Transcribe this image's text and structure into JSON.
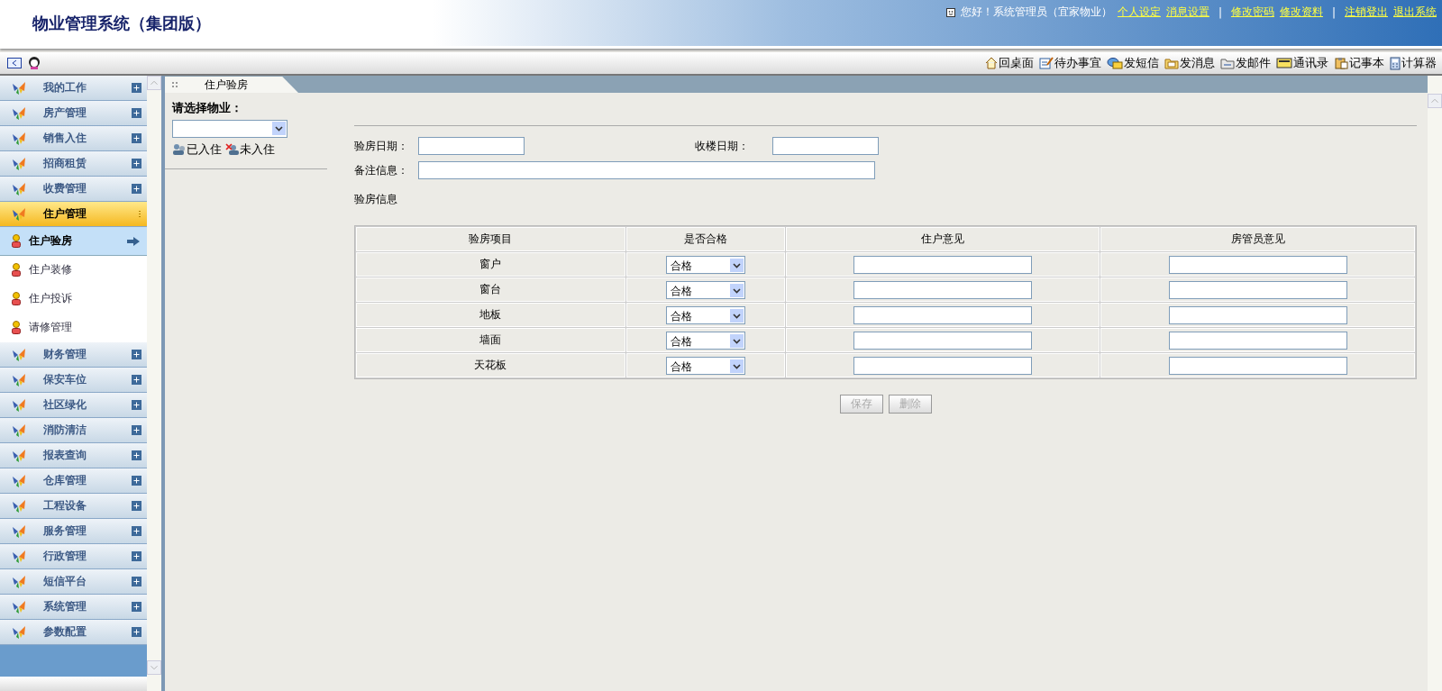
{
  "header": {
    "title": "物业管理系统（集团版）",
    "greeting": "您好！系统管理员（宜家物业）",
    "links": [
      {
        "kind": "link",
        "label": "个人设定"
      },
      {
        "kind": "link",
        "label": "消息设置"
      },
      {
        "kind": "separator",
        "label": "|"
      },
      {
        "kind": "link",
        "label": "修改密码"
      },
      {
        "kind": "link",
        "label": "修改资料"
      },
      {
        "kind": "separator",
        "label": "|"
      },
      {
        "kind": "link",
        "label": "注销登出"
      },
      {
        "kind": "link",
        "label": "退出系统"
      }
    ]
  },
  "toolbar": [
    {
      "kind": "home",
      "label": "回桌面"
    },
    {
      "kind": "todo",
      "label": "待办事宜"
    },
    {
      "kind": "sms",
      "label": "发短信"
    },
    {
      "kind": "message",
      "label": "发消息"
    },
    {
      "kind": "mail",
      "label": "发邮件"
    },
    {
      "kind": "contacts",
      "label": "通讯录"
    },
    {
      "kind": "notes",
      "label": "记事本"
    },
    {
      "kind": "calculator",
      "label": "计算器"
    }
  ],
  "sidebar": {
    "items": [
      {
        "label": "我的工作",
        "expanded": false
      },
      {
        "label": "房产管理",
        "expanded": false
      },
      {
        "label": "销售入住",
        "expanded": false
      },
      {
        "label": "招商租赁",
        "expanded": false
      },
      {
        "label": "收费管理",
        "expanded": false
      },
      {
        "label": "住户管理",
        "expanded": true,
        "children": [
          {
            "label": "住户验房",
            "selected": true
          },
          {
            "label": "住户装修",
            "selected": false
          },
          {
            "label": "住户投诉",
            "selected": false
          },
          {
            "label": "请修管理",
            "selected": false
          }
        ]
      },
      {
        "label": "财务管理",
        "expanded": false
      },
      {
        "label": "保安车位",
        "expanded": false
      },
      {
        "label": "社区绿化",
        "expanded": false
      },
      {
        "label": "消防清洁",
        "expanded": false
      },
      {
        "label": "报表查询",
        "expanded": false
      },
      {
        "label": "仓库管理",
        "expanded": false
      },
      {
        "label": "工程设备",
        "expanded": false
      },
      {
        "label": "服务管理",
        "expanded": false
      },
      {
        "label": "行政管理",
        "expanded": false
      },
      {
        "label": "短信平台",
        "expanded": false
      },
      {
        "label": "系统管理",
        "expanded": false
      },
      {
        "label": "参数配置",
        "expanded": false
      }
    ]
  },
  "tab": {
    "label": "住户验房"
  },
  "property_panel": {
    "label": "请选择物业：",
    "filters": [
      {
        "kind": "occupied",
        "label": "已入住"
      },
      {
        "kind": "vacant",
        "label": "未入住"
      }
    ]
  },
  "form": {
    "fields": [
      {
        "label": "验房日期："
      },
      {
        "label": "收楼日期："
      },
      {
        "label": "备注信息："
      }
    ],
    "section": "验房信息",
    "table": {
      "columns": [
        "验房项目",
        "是否合格",
        "住户意见",
        "房管员意见"
      ],
      "rows": [
        {
          "item": "窗户",
          "result": "合格"
        },
        {
          "item": "窗台",
          "result": "合格"
        },
        {
          "item": "地板",
          "result": "合格"
        },
        {
          "item": "墙面",
          "result": "合格"
        },
        {
          "item": "天花板",
          "result": "合格"
        }
      ]
    },
    "buttons": [
      {
        "label": "保存",
        "disabled": true
      },
      {
        "label": "删除",
        "disabled": true
      }
    ]
  }
}
